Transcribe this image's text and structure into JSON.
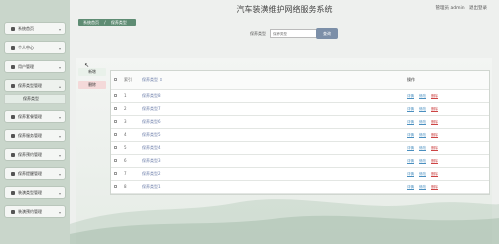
{
  "app": {
    "title": "汽车装潢维护网络服务系统"
  },
  "user": {
    "role_label": "管理员 admin",
    "logout_label": "退出登录"
  },
  "sidebar": {
    "items": [
      {
        "label": "系统首页",
        "icon": "home-icon"
      },
      {
        "label": "个人中心",
        "icon": "person-icon"
      },
      {
        "label": "用户管理",
        "icon": "users-icon"
      },
      {
        "label": "保养类型管理",
        "icon": "grid-icon",
        "open": true,
        "sub": "保养类型"
      },
      {
        "label": "保养套餐管理",
        "icon": "grid-icon"
      },
      {
        "label": "保养服务管理",
        "icon": "doc-icon"
      },
      {
        "label": "保养预约管理",
        "icon": "doc-icon"
      },
      {
        "label": "保养提醒管理",
        "icon": "doc-icon"
      },
      {
        "label": "装潢类型管理",
        "icon": "grid-icon"
      },
      {
        "label": "装潢预约管理",
        "icon": "grid-icon"
      }
    ]
  },
  "breadcrumb": {
    "home": "系统首页",
    "current": "保养类型"
  },
  "search": {
    "label": "保养类型",
    "placeholder": "保养类型",
    "button": "查询"
  },
  "actions": {
    "add": "新增",
    "delete": "删除"
  },
  "table": {
    "headers": {
      "index": "索引",
      "name": "保养类型",
      "ops": "操作"
    },
    "op_labels": {
      "detail": "详情",
      "edit": "修改",
      "delete": "删除"
    },
    "rows": [
      {
        "index": "1",
        "name": "保养类型8"
      },
      {
        "index": "2",
        "name": "保养类型7"
      },
      {
        "index": "3",
        "name": "保养类型6"
      },
      {
        "index": "4",
        "name": "保养类型5"
      },
      {
        "index": "5",
        "name": "保养类型4"
      },
      {
        "index": "6",
        "name": "保养类型3"
      },
      {
        "index": "7",
        "name": "保养类型2"
      },
      {
        "index": "8",
        "name": "保养类型1"
      }
    ]
  }
}
